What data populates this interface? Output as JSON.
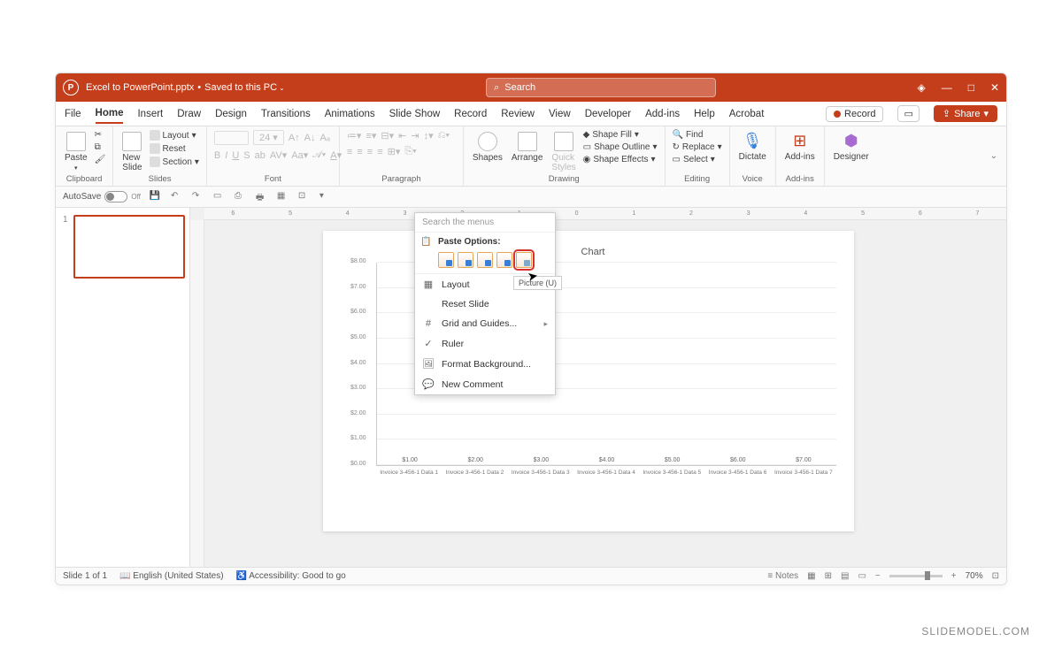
{
  "titlebar": {
    "filename": "Excel to PowerPoint.pptx",
    "saved": "Saved to this PC",
    "search_placeholder": "Search"
  },
  "menu": {
    "tabs": [
      "File",
      "Home",
      "Insert",
      "Draw",
      "Design",
      "Transitions",
      "Animations",
      "Slide Show",
      "Record",
      "Review",
      "View",
      "Developer",
      "Add-ins",
      "Help",
      "Acrobat"
    ],
    "active": "Home",
    "record": "Record",
    "share": "Share"
  },
  "ribbon": {
    "clipboard": {
      "paste": "Paste",
      "label": "Clipboard"
    },
    "slides": {
      "newslide": "New\nSlide",
      "layout": "Layout",
      "reset": "Reset",
      "section": "Section",
      "label": "Slides"
    },
    "font": {
      "label": "Font"
    },
    "paragraph": {
      "label": "Paragraph"
    },
    "drawing": {
      "shapes": "Shapes",
      "arrange": "Arrange",
      "quick": "Quick\nStyles",
      "fill": "Shape Fill",
      "outline": "Shape Outline",
      "effects": "Shape Effects",
      "label": "Drawing"
    },
    "editing": {
      "find": "Find",
      "replace": "Replace",
      "select": "Select",
      "label": "Editing"
    },
    "voice": {
      "dictate": "Dictate",
      "label": "Voice"
    },
    "addins": {
      "addins": "Add-ins",
      "label": "Add-ins"
    },
    "designer": {
      "designer": "Designer"
    }
  },
  "qat": {
    "autosave": "AutoSave",
    "off": "Off"
  },
  "thumbs": {
    "num": "1"
  },
  "hruler": [
    "6",
    "5",
    "4",
    "3",
    "2",
    "1",
    "0",
    "1",
    "2",
    "3",
    "4",
    "5",
    "6",
    "7"
  ],
  "chart_data": {
    "type": "bar",
    "title": "Chart",
    "categories": [
      "Invoice 3-456-1 Data 1",
      "Invoice 3-456-1 Data 2",
      "Invoice 3-456-1 Data 3",
      "Invoice 3-456-1 Data 4",
      "Invoice 3-456-1 Data 5",
      "Invoice 3-456-1 Data 6",
      "Invoice 3-456-1 Data 7"
    ],
    "labels": [
      "$1.00",
      "$2.00",
      "$3.00",
      "$4.00",
      "$5.00",
      "$6.00",
      "$7.00"
    ],
    "values": [
      1,
      2,
      3,
      4,
      5,
      6,
      7
    ],
    "yticks": [
      "$0.00",
      "$1.00",
      "$2.00",
      "$3.00",
      "$4.00",
      "$5.00",
      "$6.00",
      "$7.00",
      "$8.00"
    ],
    "ylim": [
      0,
      8
    ]
  },
  "contextmenu": {
    "search": "Search the menus",
    "paste_options": "Paste Options:",
    "tooltip": "Picture (U)",
    "items": {
      "layout": "Layout",
      "reset": "Reset Slide",
      "grid": "Grid and Guides...",
      "ruler": "Ruler",
      "format": "Format Background...",
      "comment": "New Comment"
    }
  },
  "statusbar": {
    "slide": "Slide 1 of 1",
    "lang": "English (United States)",
    "access": "Accessibility: Good to go",
    "notes": "Notes",
    "zoom": "70%"
  },
  "watermark": "SLIDEMODEL.COM"
}
